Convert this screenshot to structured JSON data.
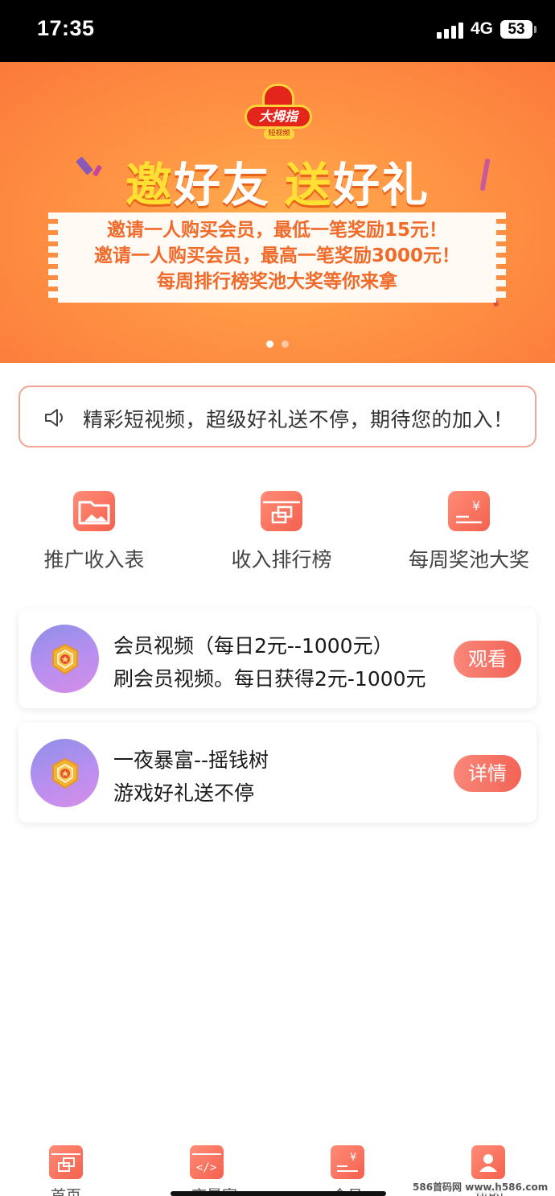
{
  "status_bar": {
    "time": "17:35",
    "network": "4G",
    "battery": "53"
  },
  "banner": {
    "logo_text": "大拇指",
    "logo_sub": "短视频",
    "title_part1": "邀",
    "title_part2": "好友",
    "title_part3": "送",
    "title_part4": "好礼",
    "lines": [
      "邀请一人购买会员，最低一笔奖励15元！",
      "邀请一人购买会员，最高一笔奖励3000元！",
      "每周排行榜奖池大奖等你来拿"
    ],
    "page_index": 1,
    "page_count": 2
  },
  "notice": {
    "text": "精彩短视频，超级好礼送不停，期待您的加入！"
  },
  "quick_actions": [
    {
      "label": "推广收入表",
      "icon": "folder-image-icon"
    },
    {
      "label": "收入排行榜",
      "icon": "layers-window-icon"
    },
    {
      "label": "每周奖池大奖",
      "icon": "yen-wallet-icon"
    }
  ],
  "cards": [
    {
      "title": "会员视频（每日2元--1000元）",
      "desc": "刷会员视频。每日获得2元-1000元",
      "button": "观看",
      "icon": "medal-icon"
    },
    {
      "title": "一夜暴富--摇钱树",
      "desc": "游戏好礼送不停",
      "button": "详情",
      "icon": "medal-icon"
    }
  ],
  "tabbar": [
    {
      "label": "首页",
      "icon": "home-window-icon"
    },
    {
      "label": "一夜暴富",
      "icon": "code-window-icon"
    },
    {
      "label": "会员",
      "icon": "yen-wallet-icon"
    },
    {
      "label": "我的",
      "icon": "user-icon"
    }
  ],
  "watermark": "586首码网 www.h586.com",
  "colors": {
    "accent": "#f36455",
    "banner": "#ff9444",
    "notice_border": "#f2a597"
  }
}
